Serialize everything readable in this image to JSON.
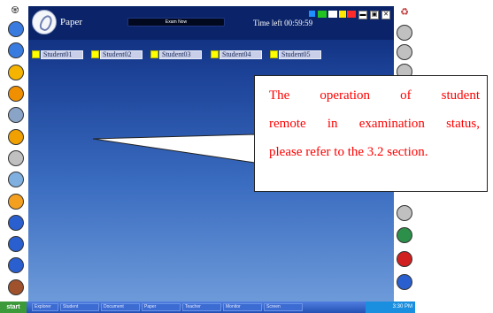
{
  "app": {
    "title": "Paper",
    "status": "Exam Now",
    "time_left": "Time left 00:59:59"
  },
  "window_controls": [
    {
      "icon": "minimize-icon",
      "glyph": "▬"
    },
    {
      "icon": "restore-icon",
      "glyph": "▣"
    },
    {
      "icon": "close-icon",
      "glyph": "✕"
    }
  ],
  "status_squares": [
    "#1e90ff",
    "#22c422",
    "#ffffff",
    "#ffe800",
    "#ff2a2a"
  ],
  "students": [
    {
      "name": "Student01",
      "color": "#ffff00"
    },
    {
      "name": "Student02",
      "color": "#ffff00"
    },
    {
      "name": "Student03",
      "color": "#ffff00"
    },
    {
      "name": "Student04",
      "color": "#ffff00"
    },
    {
      "name": "Student05",
      "color": "#ffff00"
    }
  ],
  "callout": {
    "lines": [
      "The operation of student",
      "remote in examination status,",
      "please refer to the 3.2 section."
    ]
  },
  "taskbar": {
    "start": "start",
    "tasks": [
      "Explorer",
      "Student",
      "Document",
      "Paper",
      "Teacher",
      "Monitor",
      "Screen"
    ],
    "tray": "3:30 PM"
  },
  "left_rail_buttons": [
    {
      "icon": "up-arrow-icon",
      "color": "#3a7be0"
    },
    {
      "icon": "down-arrow-icon",
      "color": "#3a7be0"
    },
    {
      "icon": "chat-icon",
      "color": "#f5b400"
    },
    {
      "icon": "broadcast-icon",
      "color": "#f09000"
    },
    {
      "icon": "monitor-icon",
      "color": "#8aa4c8"
    },
    {
      "icon": "user-icon",
      "color": "#f0a000"
    },
    {
      "icon": "document-icon",
      "color": "#c0c0c0"
    },
    {
      "icon": "network-icon",
      "color": "#7fb0e0"
    },
    {
      "icon": "hand-icon",
      "color": "#f3a020"
    },
    {
      "icon": "group-icon",
      "color": "#2a5fcf"
    },
    {
      "icon": "group-2-icon",
      "color": "#2a5fcf"
    },
    {
      "icon": "settings-icon",
      "color": "#2a5fcf"
    },
    {
      "icon": "exit-icon",
      "color": "#a0522d"
    }
  ],
  "right_rail_buttons": [
    {
      "icon": "home-icon",
      "color": "#c0c0c0"
    },
    {
      "icon": "camera-icon",
      "color": "#c0c0c0"
    },
    {
      "icon": "link-icon",
      "color": "#c0c0c0"
    },
    {
      "icon": "unlock-icon",
      "color": "#c0c0c0"
    },
    {
      "icon": "table-icon",
      "color": "#2c8f4a"
    },
    {
      "icon": "record-icon",
      "color": "#d02020"
    },
    {
      "icon": "tool-icon",
      "color": "#2a5fcf"
    }
  ]
}
